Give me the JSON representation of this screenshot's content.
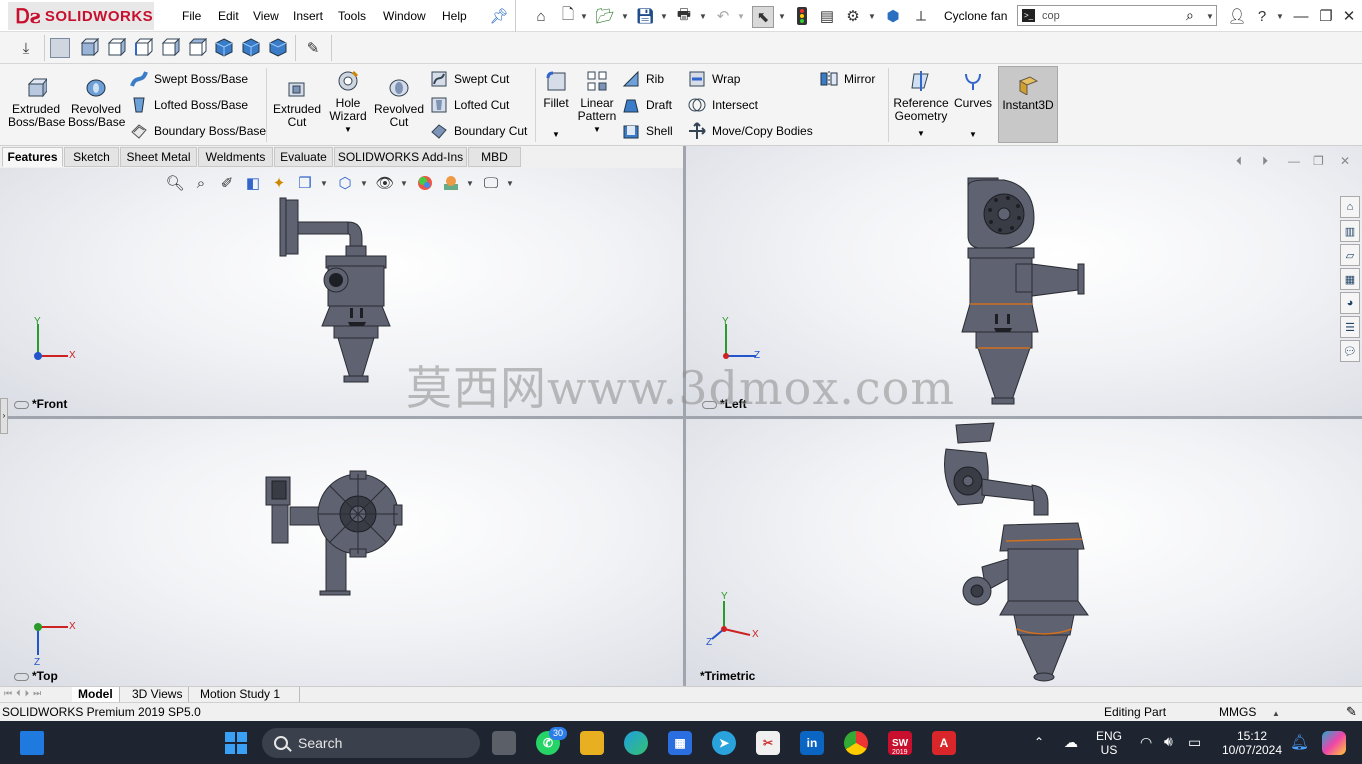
{
  "app": {
    "logo_text": "SOLIDWORKS",
    "doc_title": "Cyclone fan"
  },
  "menu": [
    "File",
    "Edit",
    "View",
    "Insert",
    "Tools",
    "Window",
    "Help"
  ],
  "search": {
    "value": "cop"
  },
  "command_manager": {
    "extruded_boss": "Extruded\nBoss/Base",
    "revolved_boss": "Revolved\nBoss/Base",
    "swept_boss": "Swept Boss/Base",
    "lofted_boss": "Lofted Boss/Base",
    "boundary_boss": "Boundary Boss/Base",
    "extruded_cut": "Extruded\nCut",
    "hole_wizard": "Hole\nWizard",
    "revolved_cut": "Revolved\nCut",
    "swept_cut": "Swept Cut",
    "lofted_cut": "Lofted Cut",
    "boundary_cut": "Boundary Cut",
    "fillet": "Fillet",
    "linear_pattern": "Linear\nPattern",
    "rib": "Rib",
    "draft": "Draft",
    "shell": "Shell",
    "wrap": "Wrap",
    "intersect": "Intersect",
    "move_copy": "Move/Copy Bodies",
    "mirror": "Mirror",
    "reference_geometry": "Reference\nGeometry",
    "curves": "Curves",
    "instant3d": "Instant3D"
  },
  "tabs": [
    "Features",
    "Sketch",
    "Sheet Metal",
    "Weldments",
    "Evaluate",
    "SOLIDWORKS Add-Ins",
    "MBD"
  ],
  "viewports": {
    "front": "*Front",
    "left": "*Left",
    "top": "*Top",
    "trimetric": "*Trimetric"
  },
  "axes": {
    "x": "X",
    "y": "Y",
    "z": "Z"
  },
  "watermark": "莫西网www.3dmox.com",
  "bottom_tabs": [
    "Model",
    "3D Views",
    "Motion Study 1"
  ],
  "status": {
    "version": "SOLIDWORKS Premium 2019 SP5.0",
    "mode": "Editing Part",
    "units": "MMGS"
  },
  "taskbar": {
    "search_label": "Search",
    "whatsapp_badge": "30",
    "lang_line1": "ENG",
    "lang_line2": "US",
    "time": "15:12",
    "date": "10/07/2024",
    "sw_badge": "2019"
  },
  "colors": {
    "accent_red": "#c8102e",
    "model_gray": "#5f6270",
    "weld_orange": "#d07020"
  }
}
